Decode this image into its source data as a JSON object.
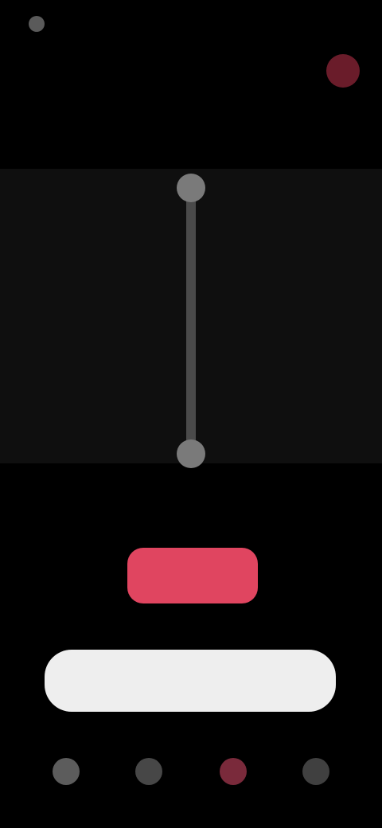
{
  "status": {
    "time_text": ""
  },
  "header": {
    "title": "",
    "subtitle": ""
  },
  "trim": {
    "duration_label": ""
  },
  "actions": {
    "primary_label": ""
  },
  "search": {
    "placeholder": ""
  },
  "nav": {
    "items": [
      {
        "icon": "home-icon"
      },
      {
        "icon": "search-icon"
      },
      {
        "icon": "record-icon"
      },
      {
        "icon": "profile-icon"
      }
    ]
  },
  "colors": {
    "accent": "#e04560",
    "background": "#000000",
    "panel": "#0f0f0f",
    "search_bg": "#eeeeee"
  }
}
